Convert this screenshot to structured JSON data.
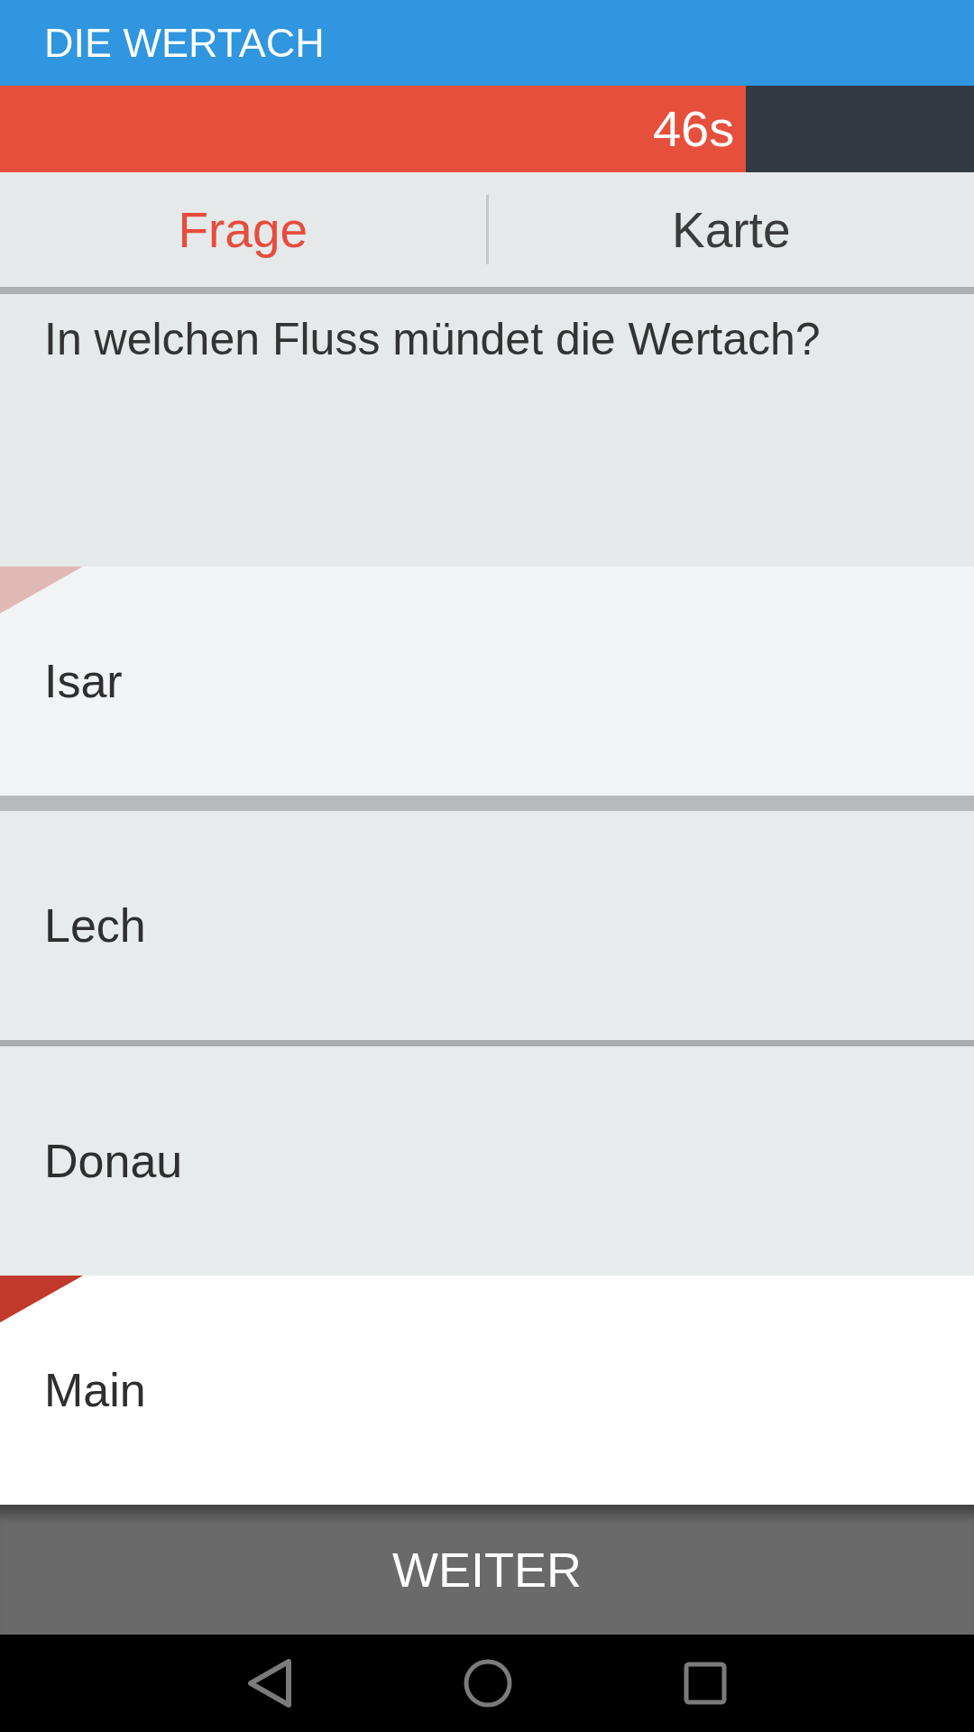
{
  "header": {
    "title": "DIE WERTACH"
  },
  "timer": {
    "level": 0.766,
    "reading": "46s"
  },
  "tabs": [
    {
      "label": "Frage",
      "selected": true
    },
    {
      "label": "Karte",
      "selected": false
    }
  ],
  "question": {
    "text": "In welchen Fluss mündet die Wertach?"
  },
  "answers": [
    {
      "label": "Isar",
      "selected": false,
      "color": "#e0b9b5"
    },
    {
      "label": "Lech",
      "selected": false
    },
    {
      "label": "Donau",
      "selected": false
    },
    {
      "label": "Main",
      "selected": true,
      "color": "#c0392b"
    }
  ],
  "next_button": {
    "label": "WEITER"
  }
}
